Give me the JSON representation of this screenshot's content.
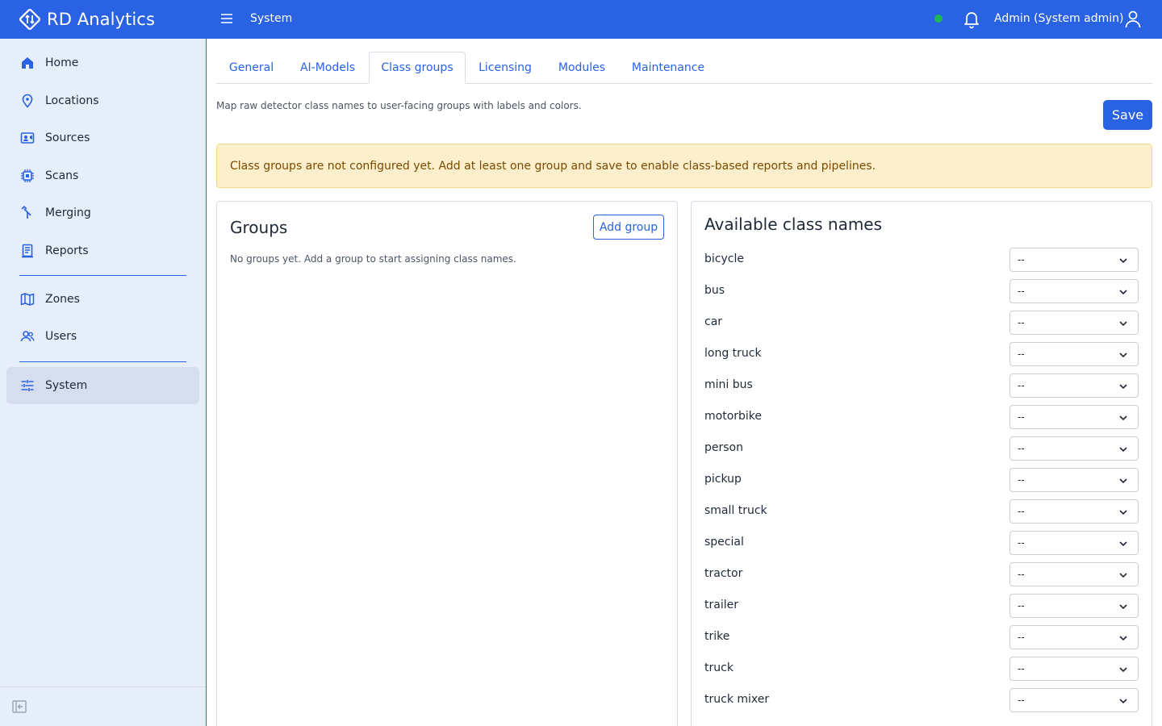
{
  "header": {
    "brand": "RD Analytics",
    "breadcrumb": "System",
    "user": "Admin (System admin)",
    "status_color": "#1fb755",
    "accent_color": "#2962e3"
  },
  "sidebar": {
    "items": [
      {
        "label": "Home",
        "icon": "home-icon"
      },
      {
        "label": "Locations",
        "icon": "map-pin-icon"
      },
      {
        "label": "Sources",
        "icon": "camera-icon"
      },
      {
        "label": "Scans",
        "icon": "chip-icon"
      },
      {
        "label": "Merging",
        "icon": "merge-icon"
      },
      {
        "label": "Reports",
        "icon": "report-icon"
      },
      {
        "label": "Zones",
        "icon": "map-icon"
      },
      {
        "label": "Users",
        "icon": "users-icon"
      },
      {
        "label": "System",
        "icon": "sliders-icon",
        "active": true
      }
    ]
  },
  "tabs": [
    {
      "label": "General"
    },
    {
      "label": "AI-Models"
    },
    {
      "label": "Class groups",
      "active": true
    },
    {
      "label": "Licensing"
    },
    {
      "label": "Modules"
    },
    {
      "label": "Maintenance"
    }
  ],
  "main": {
    "description": "Map raw detector class names to user-facing groups with labels and colors.",
    "save_label": "Save",
    "alert": "Class groups are not configured yet. Add at least one group and save to enable class-based reports and pipelines."
  },
  "groups": {
    "title": "Groups",
    "add_label": "Add group",
    "empty": "No groups yet. Add a group to start assigning class names."
  },
  "classes": {
    "title": "Available class names",
    "select_value": "--",
    "items": [
      "bicycle",
      "bus",
      "car",
      "long truck",
      "mini bus",
      "motorbike",
      "person",
      "pickup",
      "small truck",
      "special",
      "tractor",
      "trailer",
      "trike",
      "truck",
      "truck mixer"
    ]
  }
}
